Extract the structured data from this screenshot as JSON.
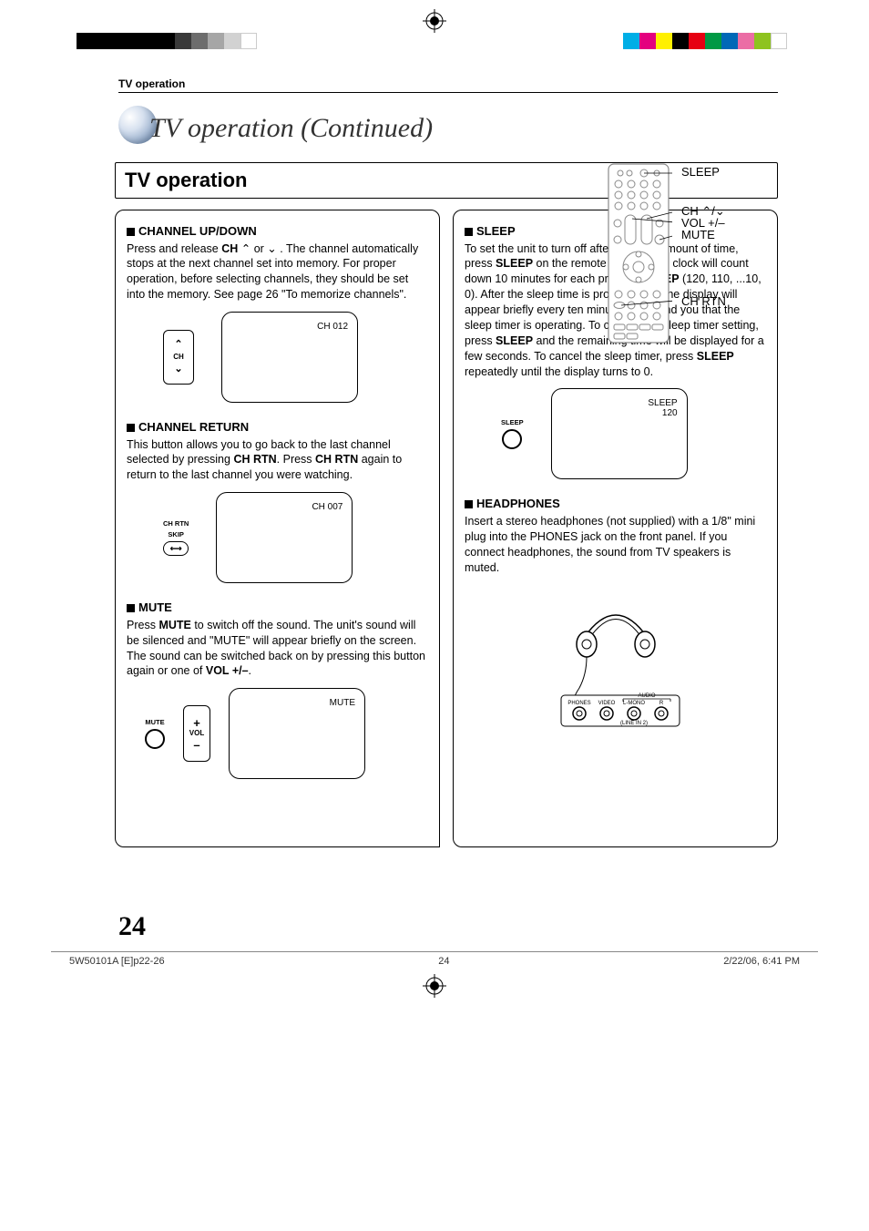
{
  "header": {
    "section": "TV operation"
  },
  "title": "TV operation (Continued)",
  "remote_labels": {
    "sleep": "SLEEP",
    "ch": "CH ⌃/⌄",
    "vol": "VOL +/–",
    "mute": "MUTE",
    "ch_rtn": "CH RTN"
  },
  "section_box_title": "TV operation",
  "left": {
    "ch_updown": {
      "heading": "CHANNEL UP/DOWN",
      "body_pre": "Press and release ",
      "body_ch": "CH",
      "body_mid": " ⌃ or ⌄ . The channel automatically stops at the next channel set into memory. For proper operation, before selecting channels, they should be set into the memory. See page 26 \"To memorize channels\".",
      "btn_label": "CH",
      "osd": "CH 012"
    },
    "ch_return": {
      "heading": "CHANNEL RETURN",
      "body_pre": "This button allows you to go back to the last channel selected by pressing ",
      "body_rtn1": "CH RTN",
      "body_mid": ". Press ",
      "body_rtn2": "CH RTN",
      "body_post": " again to return to the last channel you were watching.",
      "btn_top": "CH RTN",
      "btn_sub": "SKIP",
      "osd": "CH 007"
    },
    "mute": {
      "heading": "MUTE",
      "body_pre": "Press ",
      "body_mute": "MUTE",
      "body_mid": " to switch off the sound. The unit's sound will be silenced and \"MUTE\" will appear briefly on the screen. The sound can be switched back on by pressing this button again or one of ",
      "body_vol": "VOL +/–",
      "body_post": ".",
      "btn_label": "MUTE",
      "vol_label": "VOL",
      "osd": "MUTE"
    }
  },
  "right": {
    "sleep": {
      "heading": "SLEEP",
      "body_pre": "To set the unit to turn off after a preset amount of time, press ",
      "body_s1": "SLEEP",
      "body_mid1": " on the remote control. The clock will count down 10 minutes for each press of ",
      "body_s2": "SLEEP",
      "body_mid2": " (120, 110, ...10, 0). After the sleep time is programmed, the display will appear briefly every ten minutes to remind you that the sleep timer is operating. To confirm the sleep timer setting, press ",
      "body_s3": "SLEEP",
      "body_mid3": " and the remaining time will be displayed for a few seconds. To cancel the sleep timer, press ",
      "body_s4": "SLEEP",
      "body_post": " repeatedly until the display turns to 0.",
      "btn_label": "SLEEP",
      "osd1": "SLEEP",
      "osd2": "120"
    },
    "headphones": {
      "heading": "HEADPHONES",
      "body": "Insert a stereo headphones (not supplied) with a 1/8\" mini plug into the PHONES jack on the front panel. If you connect headphones, the sound from TV speakers is muted.",
      "jack_labels": {
        "phones": "PHONES",
        "video": "VIDEO",
        "lmono": "L-MONO",
        "r": "R",
        "audio": "AUDIO",
        "line": "(LINE IN 2)"
      }
    }
  },
  "page_number": "24",
  "footer": {
    "file": "5W50101A [E]p22-26",
    "page": "24",
    "timestamp_date": "2/22/06, 6:41 PM"
  },
  "crop_colors_left": [
    "#000",
    "#000",
    "#000",
    "#000",
    "#000",
    "#000",
    "#3a3a3a",
    "#6d6d6d",
    "#a6a6a6",
    "#d2d2d2",
    "#fff"
  ],
  "crop_colors_right": [
    "#00aee6",
    "#e4007f",
    "#fff000",
    "#000",
    "#e60012",
    "#009944",
    "#0068b7",
    "#eb6da5",
    "#8ec31f",
    "#fff"
  ]
}
